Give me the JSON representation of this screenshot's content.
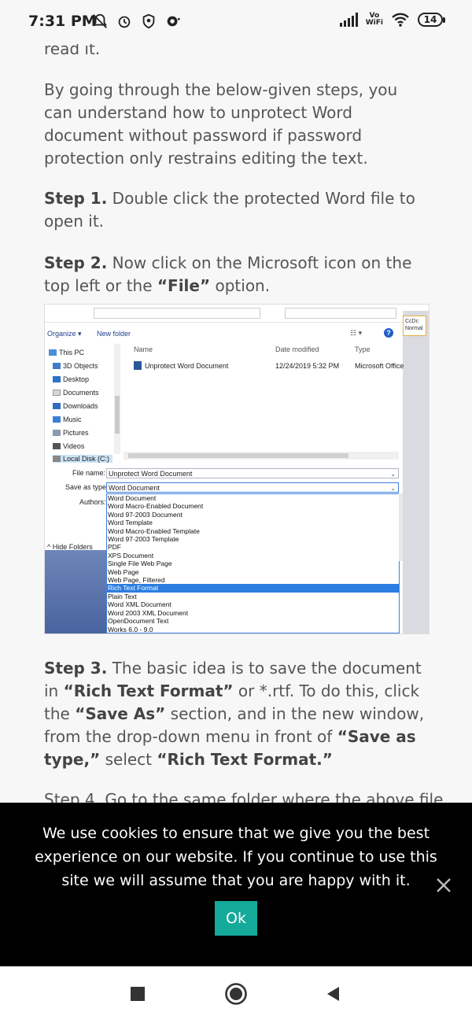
{
  "status_bar": {
    "time": "7:31 PM",
    "vowifi_top": "Vo",
    "vowifi_bottom": "WiFi",
    "battery": "14"
  },
  "article": {
    "partial_top": "read it.",
    "para1": "By going through the below-given steps, you can understand how to unprotect Word document without password if password protection only restrains editing the text.",
    "step1": {
      "label": "Step 1.",
      "text": " Double click the protected Word file to open it."
    },
    "step2": {
      "label": "Step 2.",
      "text_a": " Now click on the Microsoft icon on the top left or the ",
      "bold_a": "“File”",
      "text_b": " option."
    },
    "step3": {
      "label": "Step 3.",
      "t1": " The basic idea is to save the document in ",
      "b1": "“Rich Text Format”",
      "t2": " or *.rtf. To do this, click the ",
      "b2": "“Save As”",
      "t3": " section, and in the new window, from the drop-down menu in front of ",
      "b3": "“Save as type,”",
      "t4": " select ",
      "b4": "“Rich Text Format.”"
    },
    "step4_partial": "Step 4. Go to the same folder where the above file"
  },
  "figure": {
    "toolbar": {
      "organize": "Organize ▾",
      "new_folder": "New folder"
    },
    "right_chip": "CcDc Normal",
    "nav_items": [
      "This PC",
      "3D Objects",
      "Desktop",
      "Documents",
      "Downloads",
      "Music",
      "Pictures",
      "Videos",
      "Local Disk (C:)"
    ],
    "columns": {
      "name": "Name",
      "date": "Date modified",
      "type": "Type"
    },
    "file": {
      "name": "Unprotect Word Document",
      "date": "12/24/2019 5:32 PM",
      "type": "Microsoft Office"
    },
    "file_name_label": "File name:",
    "file_name_value": "Unprotect Word Document",
    "save_type_label": "Save as type:",
    "save_type_value": "Word Document",
    "authors_label": "Authors:",
    "hide_folders": "Hide Folders",
    "options": [
      "Word Document",
      "Word Macro-Enabled Document",
      "Word 97-2003 Document",
      "Word Template",
      "Word Macro-Enabled Template",
      "Word 97-2003 Template",
      "PDF",
      "XPS Document",
      "Single File Web Page",
      "Web Page",
      "Web Page, Filtered",
      "Rich Text Format",
      "Plain Text",
      "Word XML Document",
      "Word 2003 XML Document",
      "OpenDocument Text",
      "Works 6.0 - 9.0"
    ],
    "highlighted_index": 11
  },
  "cookie": {
    "message": "We use cookies to ensure that we give you the best experience on our website. If you continue to use this site we will assume that you are happy with it.",
    "ok_label": "Ok"
  },
  "colors": {
    "accent": "#15a99a",
    "highlight": "#2b7de0"
  }
}
